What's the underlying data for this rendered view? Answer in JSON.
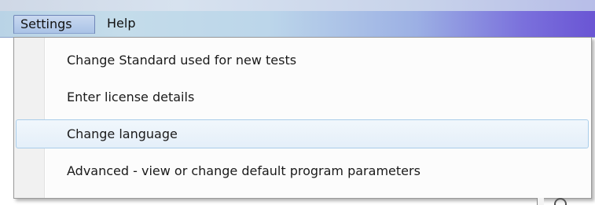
{
  "menubar": {
    "items": [
      {
        "label": "Settings",
        "active": true
      },
      {
        "label": "Help",
        "active": false
      }
    ]
  },
  "settings_menu": {
    "items": [
      {
        "label": "Change Standard used for new tests",
        "highlighted": false
      },
      {
        "label": "Enter license details",
        "highlighted": false
      },
      {
        "label": "Change language",
        "highlighted": true
      },
      {
        "label": "Advanced - view or change default program parameters",
        "highlighted": false
      }
    ]
  },
  "colors": {
    "highlight_border": "#a9cdea",
    "highlight_fill": "#e4eff9",
    "menubar_left": "#b9d3e6",
    "menubar_right": "#6a55d4"
  }
}
